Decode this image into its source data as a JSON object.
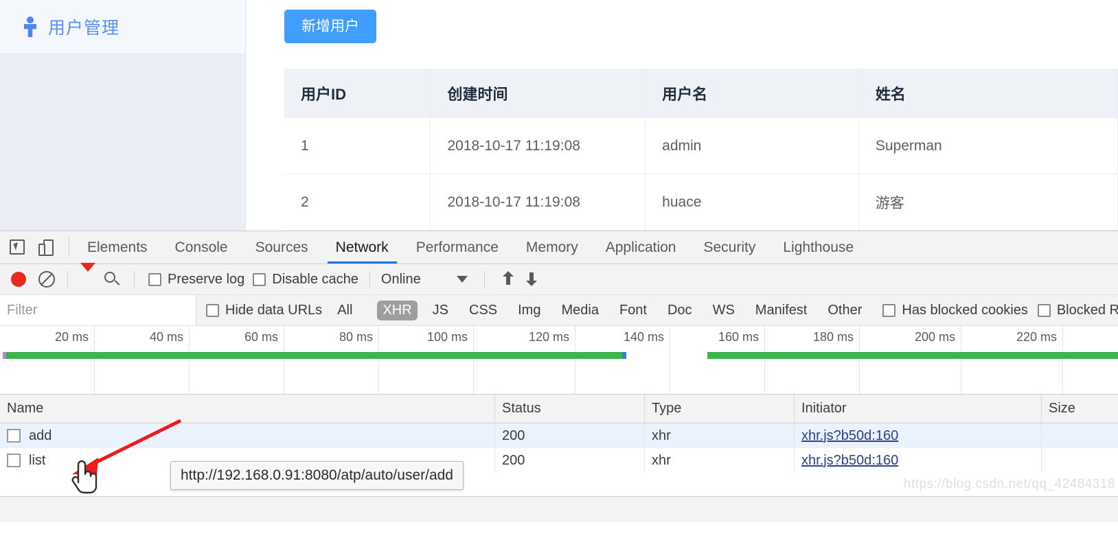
{
  "app": {
    "sidebar": {
      "title": "用户管理",
      "icon": "person-icon"
    },
    "add_user_button": "新增用户",
    "table": {
      "columns": [
        "用户ID",
        "创建时间",
        "用户名",
        "姓名"
      ],
      "rows": [
        {
          "id": "1",
          "created": "2018-10-17 11:19:08",
          "username": "admin",
          "name": "Superman"
        },
        {
          "id": "2",
          "created": "2018-10-17 11:19:08",
          "username": "huace",
          "name": "游客"
        }
      ]
    }
  },
  "devtools": {
    "tabs": [
      {
        "label": "Elements",
        "active": false
      },
      {
        "label": "Console",
        "active": false
      },
      {
        "label": "Sources",
        "active": false
      },
      {
        "label": "Network",
        "active": true
      },
      {
        "label": "Performance",
        "active": false
      },
      {
        "label": "Memory",
        "active": false
      },
      {
        "label": "Application",
        "active": false
      },
      {
        "label": "Security",
        "active": false
      },
      {
        "label": "Lighthouse",
        "active": false
      }
    ],
    "controls": {
      "record_title": "record",
      "clear_title": "clear",
      "filter_title": "filter",
      "search_title": "search",
      "preserve_log": "Preserve log",
      "disable_cache": "Disable cache",
      "throttle_value": "Online",
      "import_title": "import HAR",
      "export_title": "export HAR"
    },
    "filterbar": {
      "filter_placeholder": "Filter",
      "filter_value": "",
      "hide_data_urls": "Hide data URLs",
      "types": [
        "All",
        "XHR",
        "JS",
        "CSS",
        "Img",
        "Media",
        "Font",
        "Doc",
        "WS",
        "Manifest",
        "Other"
      ],
      "selected_type": "XHR",
      "has_blocked_cookies": "Has blocked cookies",
      "blocked_requests": "Blocked R"
    },
    "overview": {
      "ticks": [
        "20 ms",
        "40 ms",
        "60 ms",
        "80 ms",
        "100 ms",
        "120 ms",
        "140 ms",
        "160 ms",
        "180 ms",
        "200 ms",
        "220 ms"
      ],
      "band_color": "#39b54a"
    },
    "requests": {
      "columns": [
        "Name",
        "Status",
        "Type",
        "Initiator",
        "Size"
      ],
      "rows": [
        {
          "name": "add",
          "status": "200",
          "type": "xhr",
          "initiator": "xhr.js?b50d:160",
          "size": "",
          "selected": true
        },
        {
          "name": "list",
          "status": "200",
          "type": "xhr",
          "initiator": "xhr.js?b50d:160",
          "size": "",
          "selected": false
        }
      ]
    },
    "tooltip_url": "http://192.168.0.91:8080/atp/auto/user/add"
  },
  "watermark": "https://blog.csdn.net/qq_42484318"
}
